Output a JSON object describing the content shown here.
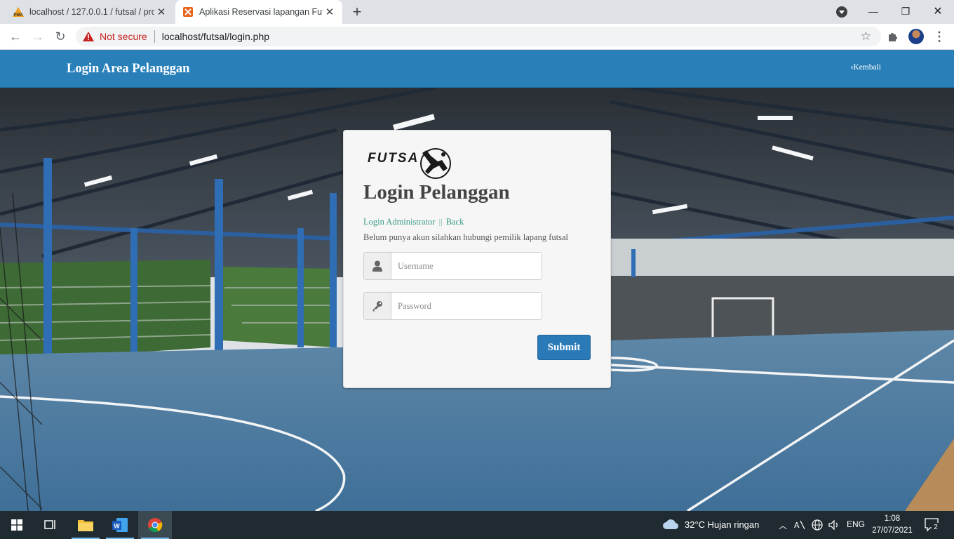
{
  "browser": {
    "tabs": [
      {
        "title": "localhost / 127.0.0.1 / futsal / pro",
        "favicon": "phpmyadmin-icon",
        "active": false
      },
      {
        "title": "Aplikasi Reservasi lapangan Futsa",
        "favicon": "xampp-icon",
        "active": true
      }
    ],
    "security_label": "Not secure",
    "url": "localhost/futsal/login.php"
  },
  "page": {
    "navbar": {
      "brand": "Login Area Pelanggan",
      "back_label": "Kembali",
      "color": "#2980b9"
    },
    "login": {
      "logo_text": "FUTSA",
      "heading": "Login Pelanggan",
      "admin_link": "Login Administrator",
      "divider": "||",
      "back_link": "Back",
      "info": "Belum punya akun silahkan hubungi pemilik lapang futsal",
      "username_placeholder": "Username",
      "password_placeholder": "Password",
      "submit_label": "Submit",
      "submit_color": "#2a7ab8"
    }
  },
  "taskbar": {
    "weather": "32°C  Hujan ringan",
    "language": "ENG",
    "time": "1:08",
    "date": "27/07/2021",
    "notifications": "2"
  }
}
